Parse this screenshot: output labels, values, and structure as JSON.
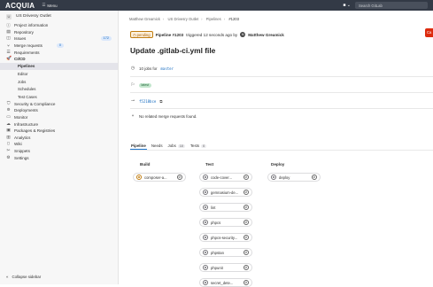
{
  "topbar": {
    "logo": "ACQUIA",
    "menu_label": "Menu",
    "search_placeholder": "Search GitLab"
  },
  "sidebar": {
    "project_initial": "U",
    "project_name": "US Drivesry Outlet",
    "items": [
      {
        "icon": "info-icon",
        "label": "Project information"
      },
      {
        "icon": "repository-icon",
        "label": "Repository"
      },
      {
        "icon": "issues-icon",
        "label": "Issues",
        "badge": "172"
      },
      {
        "icon": "merge-request-icon",
        "label": "Merge requests",
        "badge": "0"
      },
      {
        "icon": "requirements-icon",
        "label": "Requirements"
      },
      {
        "icon": "rocket-icon",
        "label": "CI/CD"
      }
    ],
    "cicd_sub": [
      "Pipelines",
      "Editor",
      "Jobs",
      "Schedules",
      "Test Cases"
    ],
    "items_after": [
      {
        "icon": "shield-icon",
        "label": "Security & Compliance"
      },
      {
        "icon": "deployments-icon",
        "label": "Deployments"
      },
      {
        "icon": "monitor-icon",
        "label": "Monitor"
      },
      {
        "icon": "infrastructure-icon",
        "label": "Infrastructure"
      },
      {
        "icon": "package-icon",
        "label": "Packages & Registries"
      },
      {
        "icon": "chart-icon",
        "label": "Analytics"
      },
      {
        "icon": "wiki-icon",
        "label": "Wiki"
      },
      {
        "icon": "snippets-icon",
        "label": "Snippets"
      },
      {
        "icon": "gear-icon",
        "label": "Settings"
      }
    ],
    "collapse_label": "Collapse sidebar"
  },
  "breadcrumb": [
    "Matthew Greamick",
    "US Drivesry Outlet",
    "Pipelines",
    "#1203"
  ],
  "pipeline": {
    "status": "pending",
    "id_text": "Pipeline #1203",
    "triggered_text": "triggered 12 seconds ago by",
    "avatar_initial": "M",
    "user": "Matthew Greamick",
    "cancel_label": "Ca",
    "title": "Update .gitlab-ci.yml file",
    "jobs_text": "10 jobs for",
    "branch": "master",
    "latest_badge": "latest",
    "commit": "f5218bce",
    "mr_text": "No related merge requests found."
  },
  "tabs": [
    {
      "label": "Pipeline",
      "count": ""
    },
    {
      "label": "Needs",
      "count": ""
    },
    {
      "label": "Jobs",
      "count": "10"
    },
    {
      "label": "Tests",
      "count": "0"
    }
  ],
  "stages": [
    {
      "name": "Build",
      "jobs": [
        "composer-a..."
      ]
    },
    {
      "name": "Test",
      "jobs": [
        "code-cover...",
        "gemnasium-de...",
        "lint",
        "phpcs",
        "phpcs-security...",
        "phpstan",
        "phpunit",
        "secret_dete..."
      ]
    },
    {
      "name": "Deploy",
      "jobs": [
        "deploy"
      ]
    }
  ]
}
